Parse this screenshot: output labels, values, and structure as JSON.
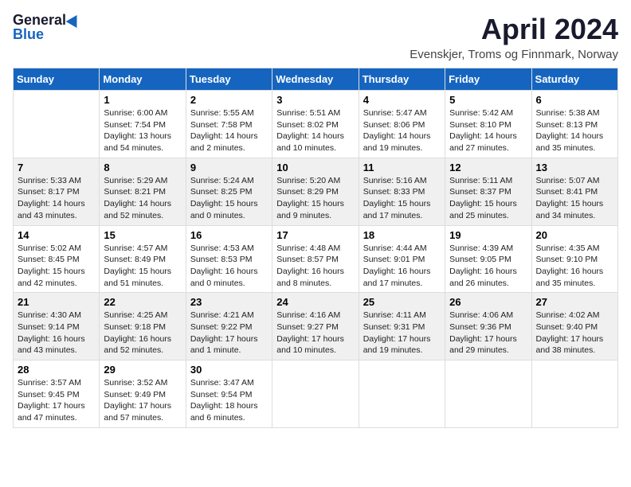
{
  "logo": {
    "line1": "General",
    "line2": "Blue"
  },
  "title": "April 2024",
  "location": "Evenskjer, Troms og Finnmark, Norway",
  "weekdays": [
    "Sunday",
    "Monday",
    "Tuesday",
    "Wednesday",
    "Thursday",
    "Friday",
    "Saturday"
  ],
  "weeks": [
    [
      {
        "day": "",
        "info": ""
      },
      {
        "day": "1",
        "info": "Sunrise: 6:00 AM\nSunset: 7:54 PM\nDaylight: 13 hours\nand 54 minutes."
      },
      {
        "day": "2",
        "info": "Sunrise: 5:55 AM\nSunset: 7:58 PM\nDaylight: 14 hours\nand 2 minutes."
      },
      {
        "day": "3",
        "info": "Sunrise: 5:51 AM\nSunset: 8:02 PM\nDaylight: 14 hours\nand 10 minutes."
      },
      {
        "day": "4",
        "info": "Sunrise: 5:47 AM\nSunset: 8:06 PM\nDaylight: 14 hours\nand 19 minutes."
      },
      {
        "day": "5",
        "info": "Sunrise: 5:42 AM\nSunset: 8:10 PM\nDaylight: 14 hours\nand 27 minutes."
      },
      {
        "day": "6",
        "info": "Sunrise: 5:38 AM\nSunset: 8:13 PM\nDaylight: 14 hours\nand 35 minutes."
      }
    ],
    [
      {
        "day": "7",
        "info": "Sunrise: 5:33 AM\nSunset: 8:17 PM\nDaylight: 14 hours\nand 43 minutes."
      },
      {
        "day": "8",
        "info": "Sunrise: 5:29 AM\nSunset: 8:21 PM\nDaylight: 14 hours\nand 52 minutes."
      },
      {
        "day": "9",
        "info": "Sunrise: 5:24 AM\nSunset: 8:25 PM\nDaylight: 15 hours\nand 0 minutes."
      },
      {
        "day": "10",
        "info": "Sunrise: 5:20 AM\nSunset: 8:29 PM\nDaylight: 15 hours\nand 9 minutes."
      },
      {
        "day": "11",
        "info": "Sunrise: 5:16 AM\nSunset: 8:33 PM\nDaylight: 15 hours\nand 17 minutes."
      },
      {
        "day": "12",
        "info": "Sunrise: 5:11 AM\nSunset: 8:37 PM\nDaylight: 15 hours\nand 25 minutes."
      },
      {
        "day": "13",
        "info": "Sunrise: 5:07 AM\nSunset: 8:41 PM\nDaylight: 15 hours\nand 34 minutes."
      }
    ],
    [
      {
        "day": "14",
        "info": "Sunrise: 5:02 AM\nSunset: 8:45 PM\nDaylight: 15 hours\nand 42 minutes."
      },
      {
        "day": "15",
        "info": "Sunrise: 4:57 AM\nSunset: 8:49 PM\nDaylight: 15 hours\nand 51 minutes."
      },
      {
        "day": "16",
        "info": "Sunrise: 4:53 AM\nSunset: 8:53 PM\nDaylight: 16 hours\nand 0 minutes."
      },
      {
        "day": "17",
        "info": "Sunrise: 4:48 AM\nSunset: 8:57 PM\nDaylight: 16 hours\nand 8 minutes."
      },
      {
        "day": "18",
        "info": "Sunrise: 4:44 AM\nSunset: 9:01 PM\nDaylight: 16 hours\nand 17 minutes."
      },
      {
        "day": "19",
        "info": "Sunrise: 4:39 AM\nSunset: 9:05 PM\nDaylight: 16 hours\nand 26 minutes."
      },
      {
        "day": "20",
        "info": "Sunrise: 4:35 AM\nSunset: 9:10 PM\nDaylight: 16 hours\nand 35 minutes."
      }
    ],
    [
      {
        "day": "21",
        "info": "Sunrise: 4:30 AM\nSunset: 9:14 PM\nDaylight: 16 hours\nand 43 minutes."
      },
      {
        "day": "22",
        "info": "Sunrise: 4:25 AM\nSunset: 9:18 PM\nDaylight: 16 hours\nand 52 minutes."
      },
      {
        "day": "23",
        "info": "Sunrise: 4:21 AM\nSunset: 9:22 PM\nDaylight: 17 hours\nand 1 minute."
      },
      {
        "day": "24",
        "info": "Sunrise: 4:16 AM\nSunset: 9:27 PM\nDaylight: 17 hours\nand 10 minutes."
      },
      {
        "day": "25",
        "info": "Sunrise: 4:11 AM\nSunset: 9:31 PM\nDaylight: 17 hours\nand 19 minutes."
      },
      {
        "day": "26",
        "info": "Sunrise: 4:06 AM\nSunset: 9:36 PM\nDaylight: 17 hours\nand 29 minutes."
      },
      {
        "day": "27",
        "info": "Sunrise: 4:02 AM\nSunset: 9:40 PM\nDaylight: 17 hours\nand 38 minutes."
      }
    ],
    [
      {
        "day": "28",
        "info": "Sunrise: 3:57 AM\nSunset: 9:45 PM\nDaylight: 17 hours\nand 47 minutes."
      },
      {
        "day": "29",
        "info": "Sunrise: 3:52 AM\nSunset: 9:49 PM\nDaylight: 17 hours\nand 57 minutes."
      },
      {
        "day": "30",
        "info": "Sunrise: 3:47 AM\nSunset: 9:54 PM\nDaylight: 18 hours\nand 6 minutes."
      },
      {
        "day": "",
        "info": ""
      },
      {
        "day": "",
        "info": ""
      },
      {
        "day": "",
        "info": ""
      },
      {
        "day": "",
        "info": ""
      }
    ]
  ]
}
